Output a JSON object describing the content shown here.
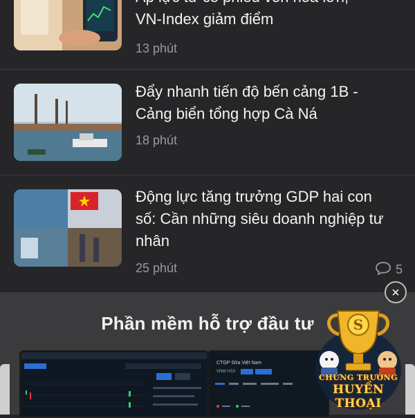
{
  "articles": [
    {
      "title": "Áp lực từ cổ phiếu vốn hóa lớn, VN-Index giảm điểm",
      "title_line1": "Áp lực từ cổ phiếu vốn hóa lớn,",
      "title_line2": "VN-Index giảm điểm",
      "time": "13 phút"
    },
    {
      "title": "Đẩy nhanh tiến độ bến cảng 1B - Cảng biển tổng hợp Cà Ná",
      "title_line1": "Đẩy nhanh tiến độ bến cảng 1B -",
      "title_line2": "Cảng biển tổng hợp Cà Ná",
      "time": "18 phút"
    },
    {
      "title": "Động lực tăng trưởng GDP hai con số: Cần những siêu doanh nghiệp tư nhân",
      "title_line1": "Động lực tăng trưởng GDP hai con",
      "title_line2": "số: Cần những siêu doanh nghiệp tư",
      "title_line3": "nhân",
      "time": "25 phút",
      "comment_count": "5"
    }
  ],
  "promo": {
    "title": "Phần mềm hỗ trợ đầu tư",
    "close_label": "×",
    "right_screen_title": "CTGP Sữa Việt Nam",
    "right_screen_sub": "VNM HSX",
    "brand_line1": "CHỨNG TRƯỜNG",
    "brand_line2": "HUYỀN THOẠI"
  },
  "icons": {
    "comment": "comment-bubble-icon",
    "close": "close-icon"
  },
  "colors": {
    "background": "#262628",
    "promo_background": "#3b3b3d",
    "meta_text": "#9a9a9c"
  }
}
